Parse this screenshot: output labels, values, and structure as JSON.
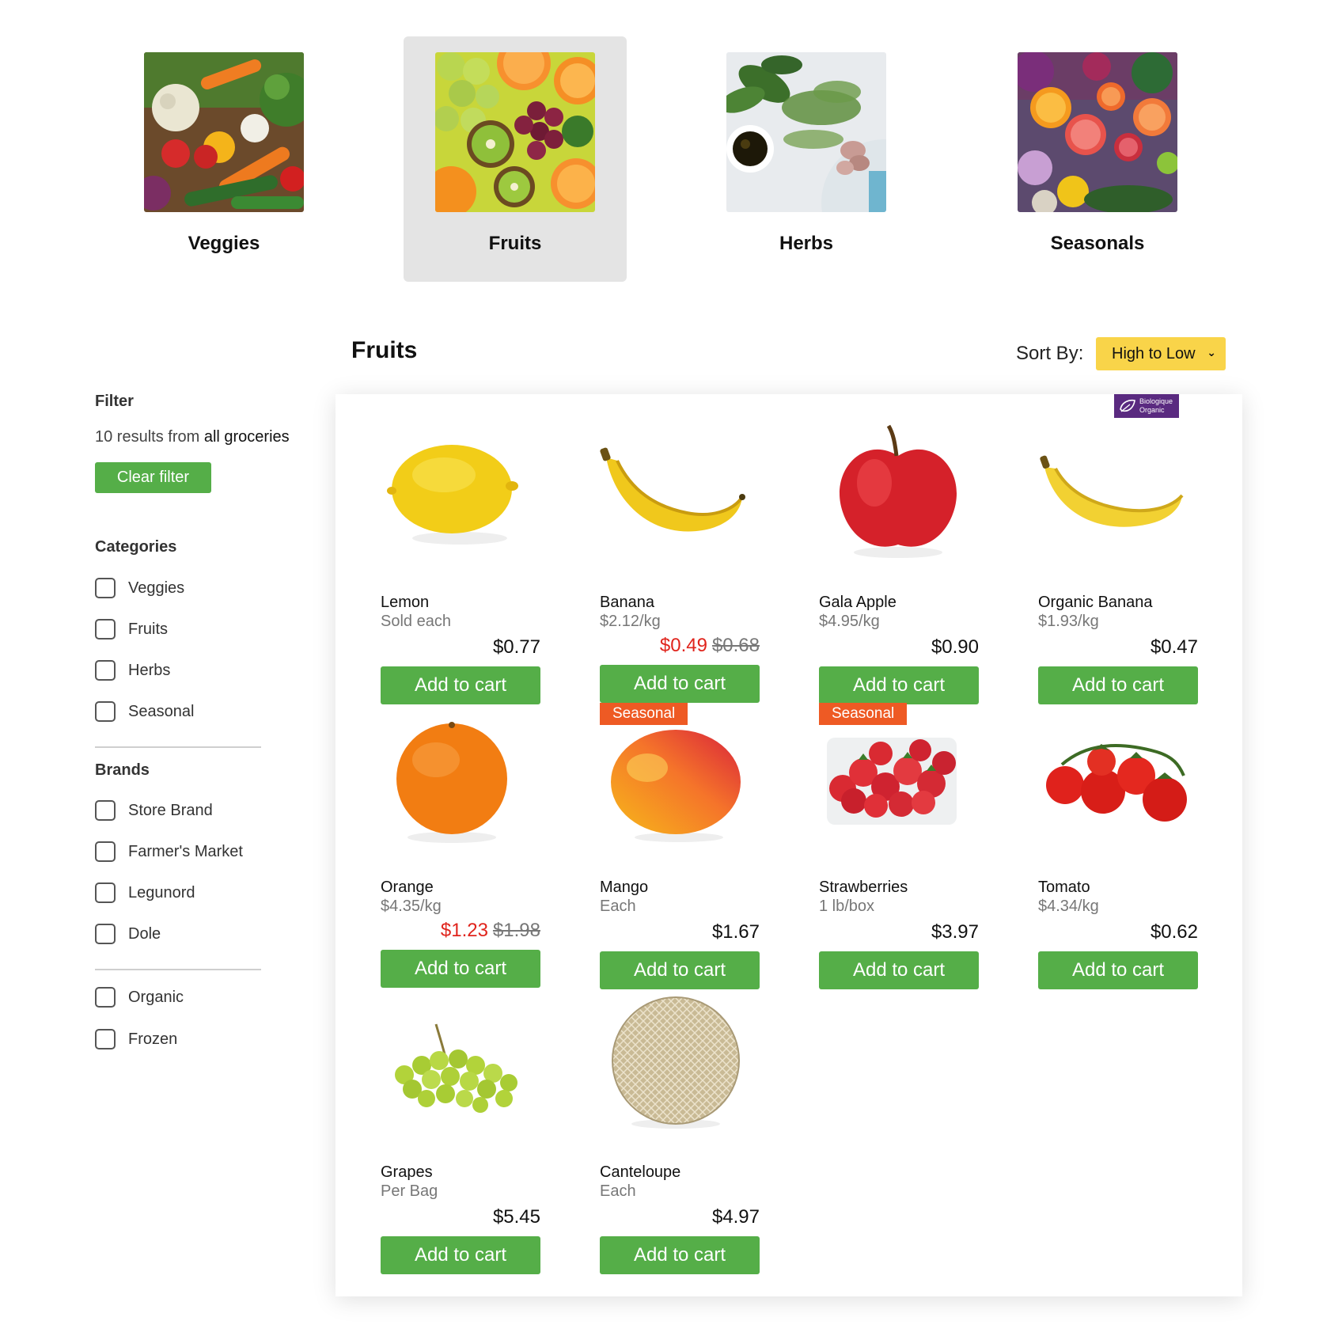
{
  "categories": [
    {
      "label": "Veggies",
      "active": false
    },
    {
      "label": "Fruits",
      "active": true
    },
    {
      "label": "Herbs",
      "active": false
    },
    {
      "label": "Seasonals",
      "active": false
    }
  ],
  "header": {
    "title": "Fruits",
    "sort_label": "Sort By:",
    "sort_value": "High to Low"
  },
  "filter": {
    "title": "Filter",
    "results_prefix": "10 results from",
    "results_scope": "all groceries",
    "clear_label": "Clear filter",
    "categories_title": "Categories",
    "categories": [
      "Veggies",
      "Fruits",
      "Herbs",
      "Seasonal"
    ],
    "brands_title": "Brands",
    "brands": [
      "Store Brand",
      "Farmer's Market",
      "Legunord",
      "Dole"
    ],
    "extras": [
      "Organic",
      "Frozen"
    ]
  },
  "products": [
    {
      "name": "Lemon",
      "unit": "Sold each",
      "price": "$0.77",
      "icon": "lemon-image"
    },
    {
      "name": "Banana",
      "unit": "$2.12/kg",
      "price": "$0.49",
      "old_price": "$0.68",
      "icon": "banana-image"
    },
    {
      "name": "Gala Apple",
      "unit": "$4.95/kg",
      "price": "$0.90",
      "icon": "apple-image"
    },
    {
      "name": "Organic Banana",
      "unit": "$1.93/kg",
      "price": "$0.47",
      "icon": "banana-image",
      "badge": "Biologique Organic"
    },
    {
      "name": "Orange",
      "unit": "$4.35/kg",
      "price": "$1.23",
      "old_price": "$1.98",
      "icon": "orange-image"
    },
    {
      "name": "Mango",
      "unit": "Each",
      "price": "$1.67",
      "icon": "mango-image",
      "badge": "Seasonal"
    },
    {
      "name": "Strawberries",
      "unit": "1 lb/box",
      "price": "$3.97",
      "icon": "strawberries-image",
      "badge": "Seasonal"
    },
    {
      "name": "Tomato",
      "unit": "$4.34/kg",
      "price": "$0.62",
      "icon": "tomato-image"
    },
    {
      "name": "Grapes",
      "unit": "Per Bag",
      "price": "$5.45",
      "icon": "grapes-image"
    },
    {
      "name": "Canteloupe",
      "unit": "Each",
      "price": "$4.97",
      "icon": "cantaloupe-image"
    }
  ],
  "add_to_cart_label": "Add to cart",
  "colors": {
    "accent_green": "#55ae48",
    "sort_yellow": "#f9d449",
    "sale_red": "#e0241c",
    "seasonal_orange": "#ee5a24",
    "organic_purple": "#5a2a80"
  }
}
